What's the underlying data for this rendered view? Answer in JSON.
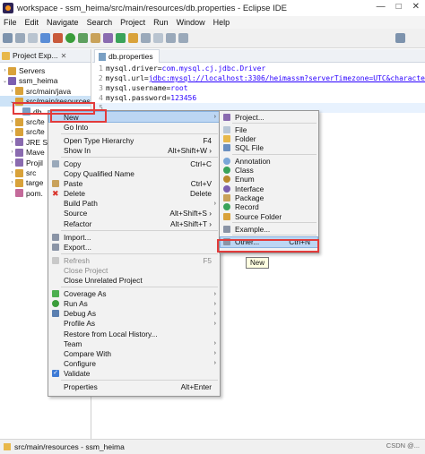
{
  "window": {
    "title": "workspace - ssm_heima/src/main/resources/db.properties - Eclipse IDE",
    "controls": [
      "—",
      "□",
      "✕"
    ]
  },
  "menubar": [
    "File",
    "Edit",
    "Navigate",
    "Search",
    "Project",
    "Run",
    "Window",
    "Help"
  ],
  "project_explorer": {
    "title": "Project Exp...",
    "items": [
      {
        "label": "Servers",
        "level": 0,
        "arrow": "›",
        "color": "#d9a23a"
      },
      {
        "label": "ssm_heima",
        "level": 0,
        "arrow": "⌄",
        "color": "#7b5fb0"
      },
      {
        "label": "src/main/java",
        "level": 1,
        "arrow": "›",
        "color": "#d9a23a"
      },
      {
        "label": "src/main/resources",
        "level": 1,
        "arrow": "⌄",
        "color": "#d9a23a"
      },
      {
        "label": "db.",
        "level": 2,
        "arrow": "",
        "color": "#7aa0c4"
      },
      {
        "label": "src/te",
        "level": 1,
        "arrow": "›",
        "color": "#d9a23a"
      },
      {
        "label": "src/te",
        "level": 1,
        "arrow": "›",
        "color": "#d9a23a"
      },
      {
        "label": "JRE Sy",
        "level": 1,
        "arrow": "›",
        "color": "#8a6bb0"
      },
      {
        "label": "Mave",
        "level": 1,
        "arrow": "›",
        "color": "#8a6bb0"
      },
      {
        "label": "Projil",
        "level": 1,
        "arrow": "›",
        "color": "#8a6bb0"
      },
      {
        "label": "src",
        "level": 1,
        "arrow": "›",
        "color": "#d9a23a"
      },
      {
        "label": "targe",
        "level": 1,
        "arrow": "›",
        "color": "#d9a23a"
      },
      {
        "label": "pom.",
        "level": 1,
        "arrow": "",
        "color": "#c46a9a"
      }
    ]
  },
  "editor": {
    "tab": "db.properties",
    "lines": [
      {
        "n": "1",
        "key": "mysql.driver=",
        "val": "com.mysql.cj.jdbc.Driver"
      },
      {
        "n": "2",
        "key": "mysql.url=",
        "val": "jdbc:mysql://localhost:3306/heimassm?serverTimezone=UTC&characte"
      },
      {
        "n": "3",
        "key": "mysql.username=",
        "val": "root"
      },
      {
        "n": "4",
        "key": "mysql.password=",
        "val": "123456"
      },
      {
        "n": "5",
        "key": "",
        "val": ""
      }
    ]
  },
  "context_menu": [
    {
      "label": "New",
      "arrow": "›",
      "highlight": true
    },
    {
      "label": "Go Into"
    },
    {
      "sep": true
    },
    {
      "label": "Open Type Hierarchy",
      "shortcut": "F4"
    },
    {
      "label": "Show In",
      "shortcut": "Alt+Shift+W ›"
    },
    {
      "sep": true
    },
    {
      "label": "Copy",
      "shortcut": "Ctrl+C",
      "icon": "copy-icon",
      "iconColor": "#9aa9ba"
    },
    {
      "label": "Copy Qualified Name"
    },
    {
      "label": "Paste",
      "shortcut": "Ctrl+V",
      "icon": "paste-icon",
      "iconColor": "#c9a25a"
    },
    {
      "label": "Delete",
      "shortcut": "Delete",
      "icon": "delete-icon",
      "iconColor": "#d9342b"
    },
    {
      "label": "Build Path",
      "arrow": "›"
    },
    {
      "label": "Source",
      "shortcut": "Alt+Shift+S ›"
    },
    {
      "label": "Refactor",
      "shortcut": "Alt+Shift+T ›"
    },
    {
      "sep": true
    },
    {
      "label": "Import...",
      "icon": "import-icon",
      "iconColor": "#8a94a6"
    },
    {
      "label": "Export...",
      "icon": "export-icon",
      "iconColor": "#8a94a6"
    },
    {
      "sep": true
    },
    {
      "label": "Refresh",
      "shortcut": "F5",
      "icon": "refresh-icon",
      "iconColor": "#c9c9c9",
      "disabled": true
    },
    {
      "label": "Close Project",
      "disabled": true
    },
    {
      "label": "Close Unrelated Project"
    },
    {
      "sep": true
    },
    {
      "label": "Coverage As",
      "arrow": "›",
      "icon": "coverage-icon",
      "iconColor": "#4caf50"
    },
    {
      "label": "Run As",
      "arrow": "›",
      "icon": "run-icon",
      "iconColor": "#3a9d3a"
    },
    {
      "label": "Debug As",
      "arrow": "›",
      "icon": "debug-icon",
      "iconColor": "#5a7fb0"
    },
    {
      "label": "Profile As",
      "arrow": "›"
    },
    {
      "label": "Restore from Local History..."
    },
    {
      "label": "Team",
      "arrow": "›"
    },
    {
      "label": "Compare With",
      "arrow": "›"
    },
    {
      "label": "Configure",
      "arrow": "›"
    },
    {
      "label": "Validate",
      "icon": "validate-icon",
      "iconColor": "#3e7bd6"
    },
    {
      "sep": true
    },
    {
      "label": "Properties",
      "shortcut": "Alt+Enter"
    }
  ],
  "submenu": [
    {
      "label": "Project...",
      "icon": "project-icon",
      "iconColor": "#8a6bb0"
    },
    {
      "sep": true
    },
    {
      "label": "File",
      "icon": "file-icon",
      "iconColor": "#b8c6d6"
    },
    {
      "label": "Folder",
      "icon": "folder-icon",
      "iconColor": "#e8b84a"
    },
    {
      "label": "SQL File",
      "icon": "sql-file-icon",
      "iconColor": "#6a8fc0"
    },
    {
      "sep": true
    },
    {
      "label": "Annotation",
      "icon": "annotation-icon",
      "iconColor": "#7aa7d8"
    },
    {
      "label": "Class",
      "icon": "class-icon",
      "iconColor": "#3aa35a"
    },
    {
      "label": "Enum",
      "icon": "enum-icon",
      "iconColor": "#b9892c"
    },
    {
      "label": "Interface",
      "icon": "interface-icon",
      "iconColor": "#7b5fb0"
    },
    {
      "label": "Package",
      "icon": "package-icon",
      "iconColor": "#c9a25a"
    },
    {
      "label": "Record",
      "icon": "record-icon",
      "iconColor": "#3aa35a"
    },
    {
      "label": "Source Folder",
      "icon": "source-folder-icon",
      "iconColor": "#d9a23a"
    },
    {
      "sep": true
    },
    {
      "label": "Example...",
      "icon": "example-icon",
      "iconColor": "#8a94a6"
    },
    {
      "sep": true
    },
    {
      "label": "Other...",
      "shortcut": "Ctrl+N",
      "icon": "other-icon",
      "iconColor": "#8a94a6",
      "highlight": true
    }
  ],
  "tooltip": "New",
  "status": "src/main/resources - ssm_heima",
  "watermark": "CSDN @..."
}
